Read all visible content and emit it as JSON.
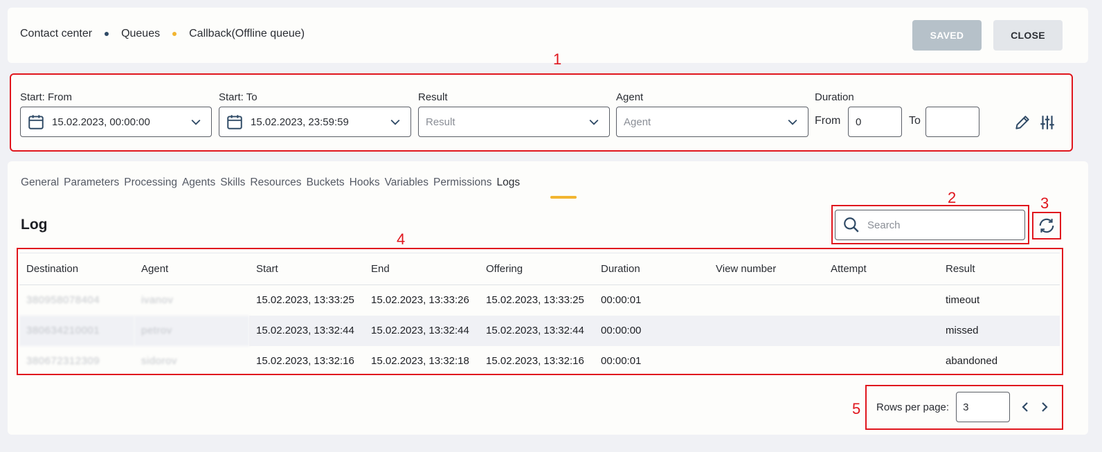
{
  "header": {
    "breadcrumb": [
      "Contact center",
      "Queues",
      "Callback(Offline queue)"
    ],
    "saved_label": "SAVED",
    "close_label": "CLOSE"
  },
  "annotations": [
    "1",
    "2",
    "3",
    "4",
    "5"
  ],
  "filters": {
    "start_from": {
      "label": "Start: From",
      "value": "15.02.2023, 00:00:00"
    },
    "start_to": {
      "label": "Start: To",
      "value": "15.02.2023, 23:59:59"
    },
    "result": {
      "label": "Result",
      "placeholder": "Result"
    },
    "agent": {
      "label": "Agent",
      "placeholder": "Agent"
    },
    "duration": {
      "label": "Duration",
      "from_label": "From",
      "from_value": "0",
      "to_label": "To",
      "to_value": ""
    }
  },
  "tabs": [
    "General",
    "Parameters",
    "Processing",
    "Agents",
    "Skills",
    "Resources",
    "Buckets",
    "Hooks",
    "Variables",
    "Permissions",
    "Logs"
  ],
  "active_tab": "Logs",
  "log": {
    "title": "Log",
    "search_placeholder": "Search",
    "columns": [
      "Destination",
      "Agent",
      "Start",
      "End",
      "Offering",
      "Duration",
      "View number",
      "Attempt",
      "Result"
    ],
    "rows": [
      [
        "380958078404",
        "ivanov",
        "15.02.2023, 13:33:25",
        "15.02.2023, 13:33:26",
        "15.02.2023, 13:33:25",
        "00:00:01",
        "",
        "",
        "timeout"
      ],
      [
        "380634210001",
        "petrov",
        "15.02.2023, 13:32:44",
        "15.02.2023, 13:32:44",
        "15.02.2023, 13:32:44",
        "00:00:00",
        "",
        "",
        "missed"
      ],
      [
        "380672312309",
        "sidorov",
        "15.02.2023, 13:32:16",
        "15.02.2023, 13:32:18",
        "15.02.2023, 13:32:16",
        "00:00:01",
        "",
        "",
        "abandoned"
      ]
    ]
  },
  "pager": {
    "rows_label": "Rows per page:",
    "rows_value": "3"
  },
  "colors": {
    "accent": "#f2b531",
    "annotation": "#e0161d",
    "saved_bg": "#b6c1c9",
    "close_bg": "#e3e6ea"
  },
  "icons": [
    "calendar-icon",
    "chevron-down-icon",
    "pencil-icon",
    "sliders-icon",
    "search-icon",
    "refresh-icon",
    "chevron-left-icon",
    "chevron-right-icon"
  ]
}
